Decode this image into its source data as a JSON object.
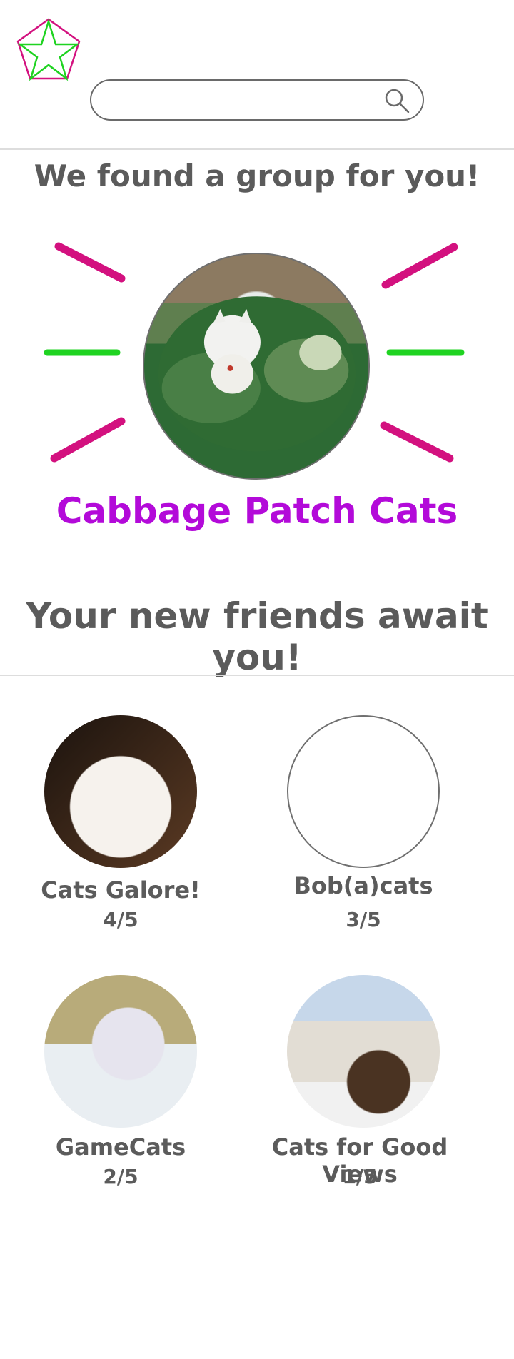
{
  "header": {
    "logo_icon": "star-pentagon-logo-icon",
    "search": {
      "value": "",
      "placeholder": "",
      "icon": "search-icon"
    }
  },
  "match": {
    "headline": "We found a group for you!",
    "group_name": "Cabbage Patch Cats",
    "accent_color": "#b30ad9",
    "ray_colors": {
      "magenta": "#d3117f",
      "green": "#1fd321"
    }
  },
  "friends": {
    "headline": "Your new friends await you!",
    "groups": [
      {
        "name": "Cats Galore!",
        "count": "4/5",
        "image": "white-cat-photo"
      },
      {
        "name": "Bob(a)cats",
        "count": "3/5",
        "image": ""
      },
      {
        "name": "GameCats",
        "count": "2/5",
        "image": "kitten-with-controller-photo"
      },
      {
        "name": "Cats for Good Views",
        "count": "1/5",
        "image": "cat-overlooking-town-photo"
      }
    ]
  }
}
